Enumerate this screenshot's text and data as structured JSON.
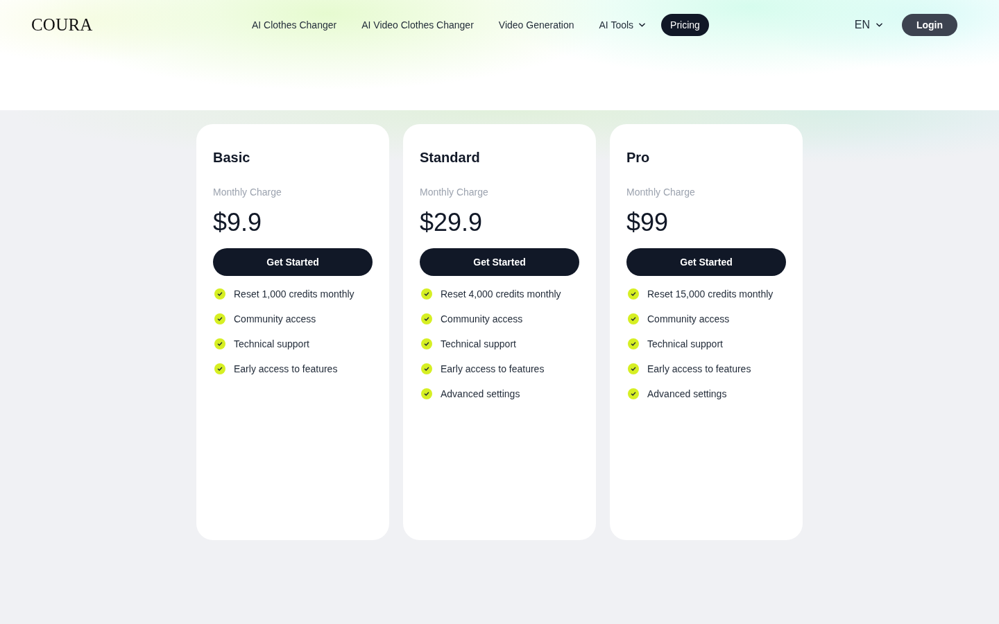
{
  "header": {
    "logo": "COURA",
    "nav": [
      {
        "label": "AI Clothes Changer",
        "kind": "link",
        "selected": false
      },
      {
        "label": "AI Video Clothes Changer",
        "kind": "link",
        "selected": false
      },
      {
        "label": "Video Generation",
        "kind": "link",
        "selected": false
      },
      {
        "label": "AI Tools",
        "kind": "dropdown",
        "selected": false
      },
      {
        "label": "Pricing",
        "kind": "link",
        "selected": true
      }
    ],
    "language": "EN",
    "login": "Login"
  },
  "plans": [
    {
      "name": "Basic",
      "period": "Monthly Charge",
      "price": "$9.9",
      "button": "Get Started",
      "features": [
        "Reset 1,000 credits monthly",
        "Community access",
        "Technical support",
        "Early access to features"
      ]
    },
    {
      "name": "Standard",
      "period": "Monthly Charge",
      "price": "$29.9",
      "button": "Get Started",
      "features": [
        "Reset 4,000 credits monthly",
        "Community access",
        "Technical support",
        "Early access to features",
        "Advanced settings"
      ]
    },
    {
      "name": "Pro",
      "period": "Monthly Charge",
      "price": "$99",
      "button": "Get Started",
      "features": [
        "Reset 15,000 credits monthly",
        "Community access",
        "Technical support",
        "Early access to features",
        "Advanced settings"
      ]
    }
  ]
}
